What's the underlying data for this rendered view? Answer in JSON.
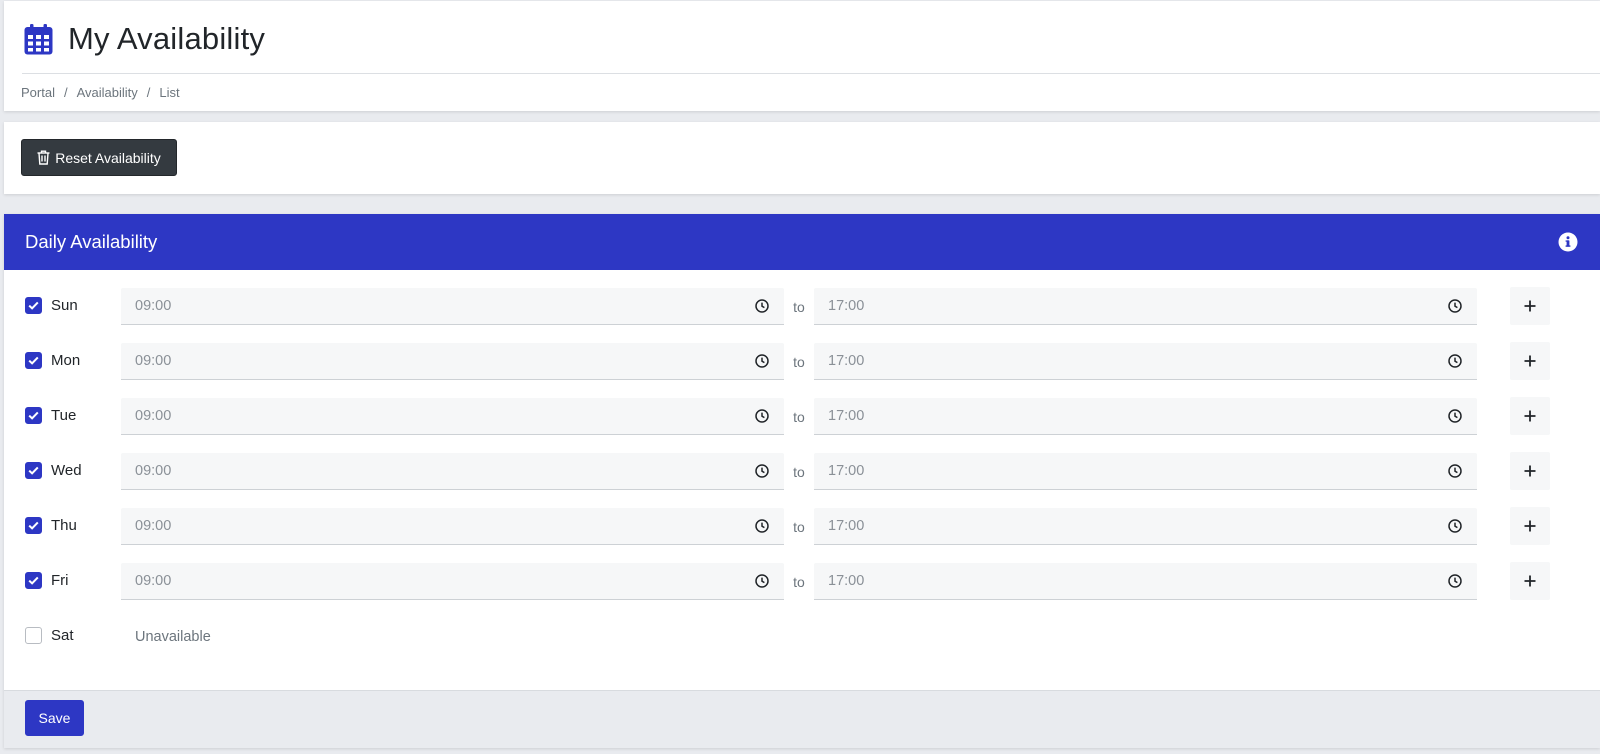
{
  "header": {
    "title": "My Availability",
    "icon": "calendar-icon",
    "breadcrumb": [
      "Portal",
      "Availability",
      "List"
    ],
    "breadcrumb_separator": "/"
  },
  "toolbar": {
    "reset_label": "Reset Availability",
    "reset_icon": "trash-icon"
  },
  "availability": {
    "title": "Daily Availability",
    "info_icon": "info-icon",
    "to_label": "to",
    "unavailable_label": "Unavailable",
    "days": [
      {
        "label": "Sun",
        "enabled": true,
        "start": "09:00",
        "end": "17:00"
      },
      {
        "label": "Mon",
        "enabled": true,
        "start": "09:00",
        "end": "17:00"
      },
      {
        "label": "Tue",
        "enabled": true,
        "start": "09:00",
        "end": "17:00"
      },
      {
        "label": "Wed",
        "enabled": true,
        "start": "09:00",
        "end": "17:00"
      },
      {
        "label": "Thu",
        "enabled": true,
        "start": "09:00",
        "end": "17:00"
      },
      {
        "label": "Fri",
        "enabled": true,
        "start": "09:00",
        "end": "17:00"
      },
      {
        "label": "Sat",
        "enabled": false,
        "start": "",
        "end": ""
      }
    ],
    "save_label": "Save"
  },
  "colors": {
    "primary": "#2d37c4",
    "dark_button": "#343a40",
    "page_background": "#e9ebef",
    "input_background": "#f6f7f8"
  }
}
